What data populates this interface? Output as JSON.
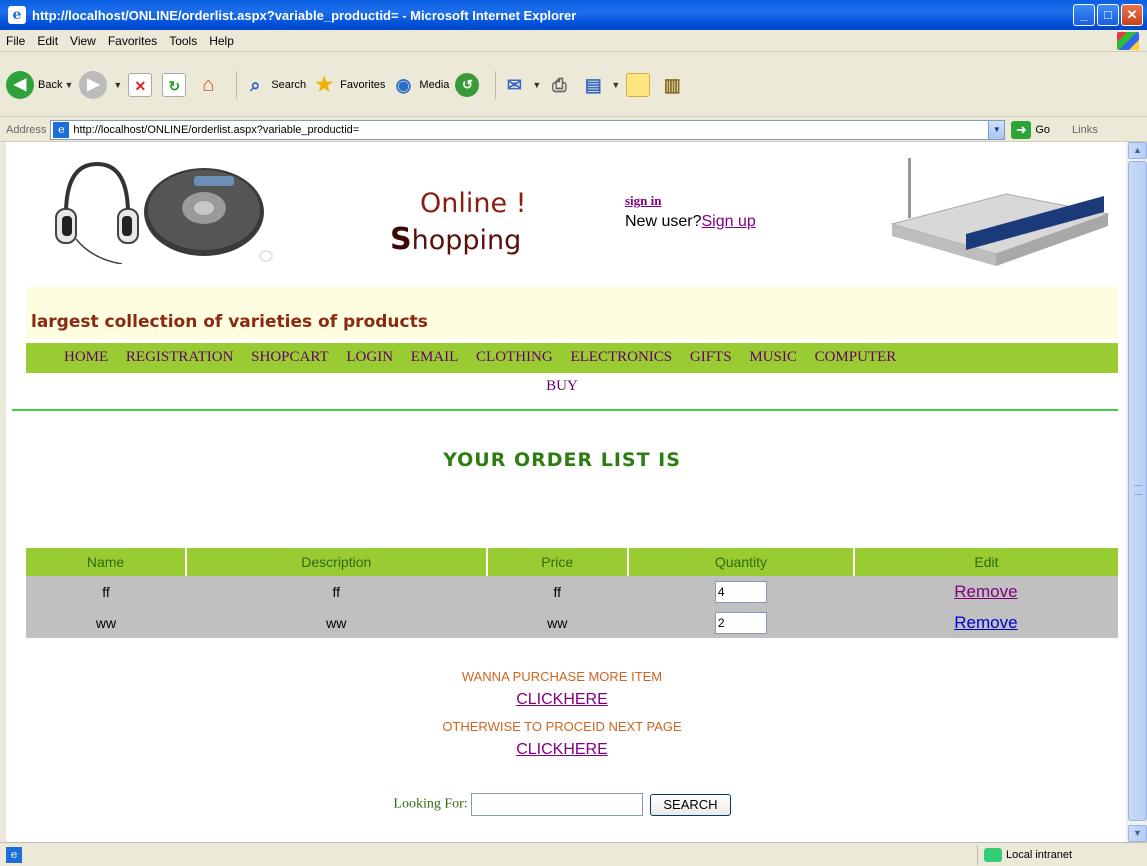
{
  "window": {
    "title": "http://localhost/ONLINE/orderlist.aspx?variable_productid= - Microsoft Internet Explorer",
    "min": "_",
    "max": "□",
    "close": "✕"
  },
  "menu": [
    "File",
    "Edit",
    "View",
    "Favorites",
    "Tools",
    "Help"
  ],
  "toolbar": {
    "back": "Back",
    "search": "Search",
    "favorites": "Favorites",
    "media": "Media"
  },
  "address": {
    "label": "Address",
    "url": "http://localhost/ONLINE/orderlist.aspx?variable_productid=",
    "go": "Go",
    "links": "Links"
  },
  "header": {
    "logo_line1": "Online !",
    "logo_line2_big": "S",
    "logo_line2_rest": "hopping",
    "signin": "sign in",
    "newuser_text": "New user?",
    "signup": "Sign up",
    "tagline": "largest collection of varieties of products"
  },
  "nav": {
    "items": [
      "HOME",
      "REGISTRATION",
      "SHOPCART",
      "LOGIN",
      "EMAIL",
      "CLOTHING",
      "ELECTRONICS",
      "GIFTS",
      "MUSIC",
      "COMPUTER"
    ],
    "buy": "BUY"
  },
  "order": {
    "title": "YOUR ORDER LIST IS",
    "columns": [
      "Name",
      "Description",
      "Price",
      "Quantity",
      "Edit"
    ],
    "rows": [
      {
        "name": "ff",
        "description": "ff",
        "price": "ff",
        "quantity": "4",
        "edit": "Remove"
      },
      {
        "name": "ww",
        "description": "ww",
        "price": "ww",
        "quantity": "2",
        "edit": "Remove"
      }
    ]
  },
  "cta": {
    "more_text": "WANNA PURCHASE MORE ITEM",
    "more_link": "CLICKHERE",
    "next_text": "OTHERWISE TO PROCEID NEXT PAGE",
    "next_link": "CLICKHERE"
  },
  "search": {
    "label": "Looking For:",
    "value": "",
    "button": "SEARCH"
  },
  "status": {
    "zone": "Local intranet"
  },
  "colors": {
    "nav_bg": "#99CC33",
    "tagline_bg": "#FFFDE0",
    "title_green": "#2E7D12",
    "row_bg": "#C0C0C0"
  }
}
